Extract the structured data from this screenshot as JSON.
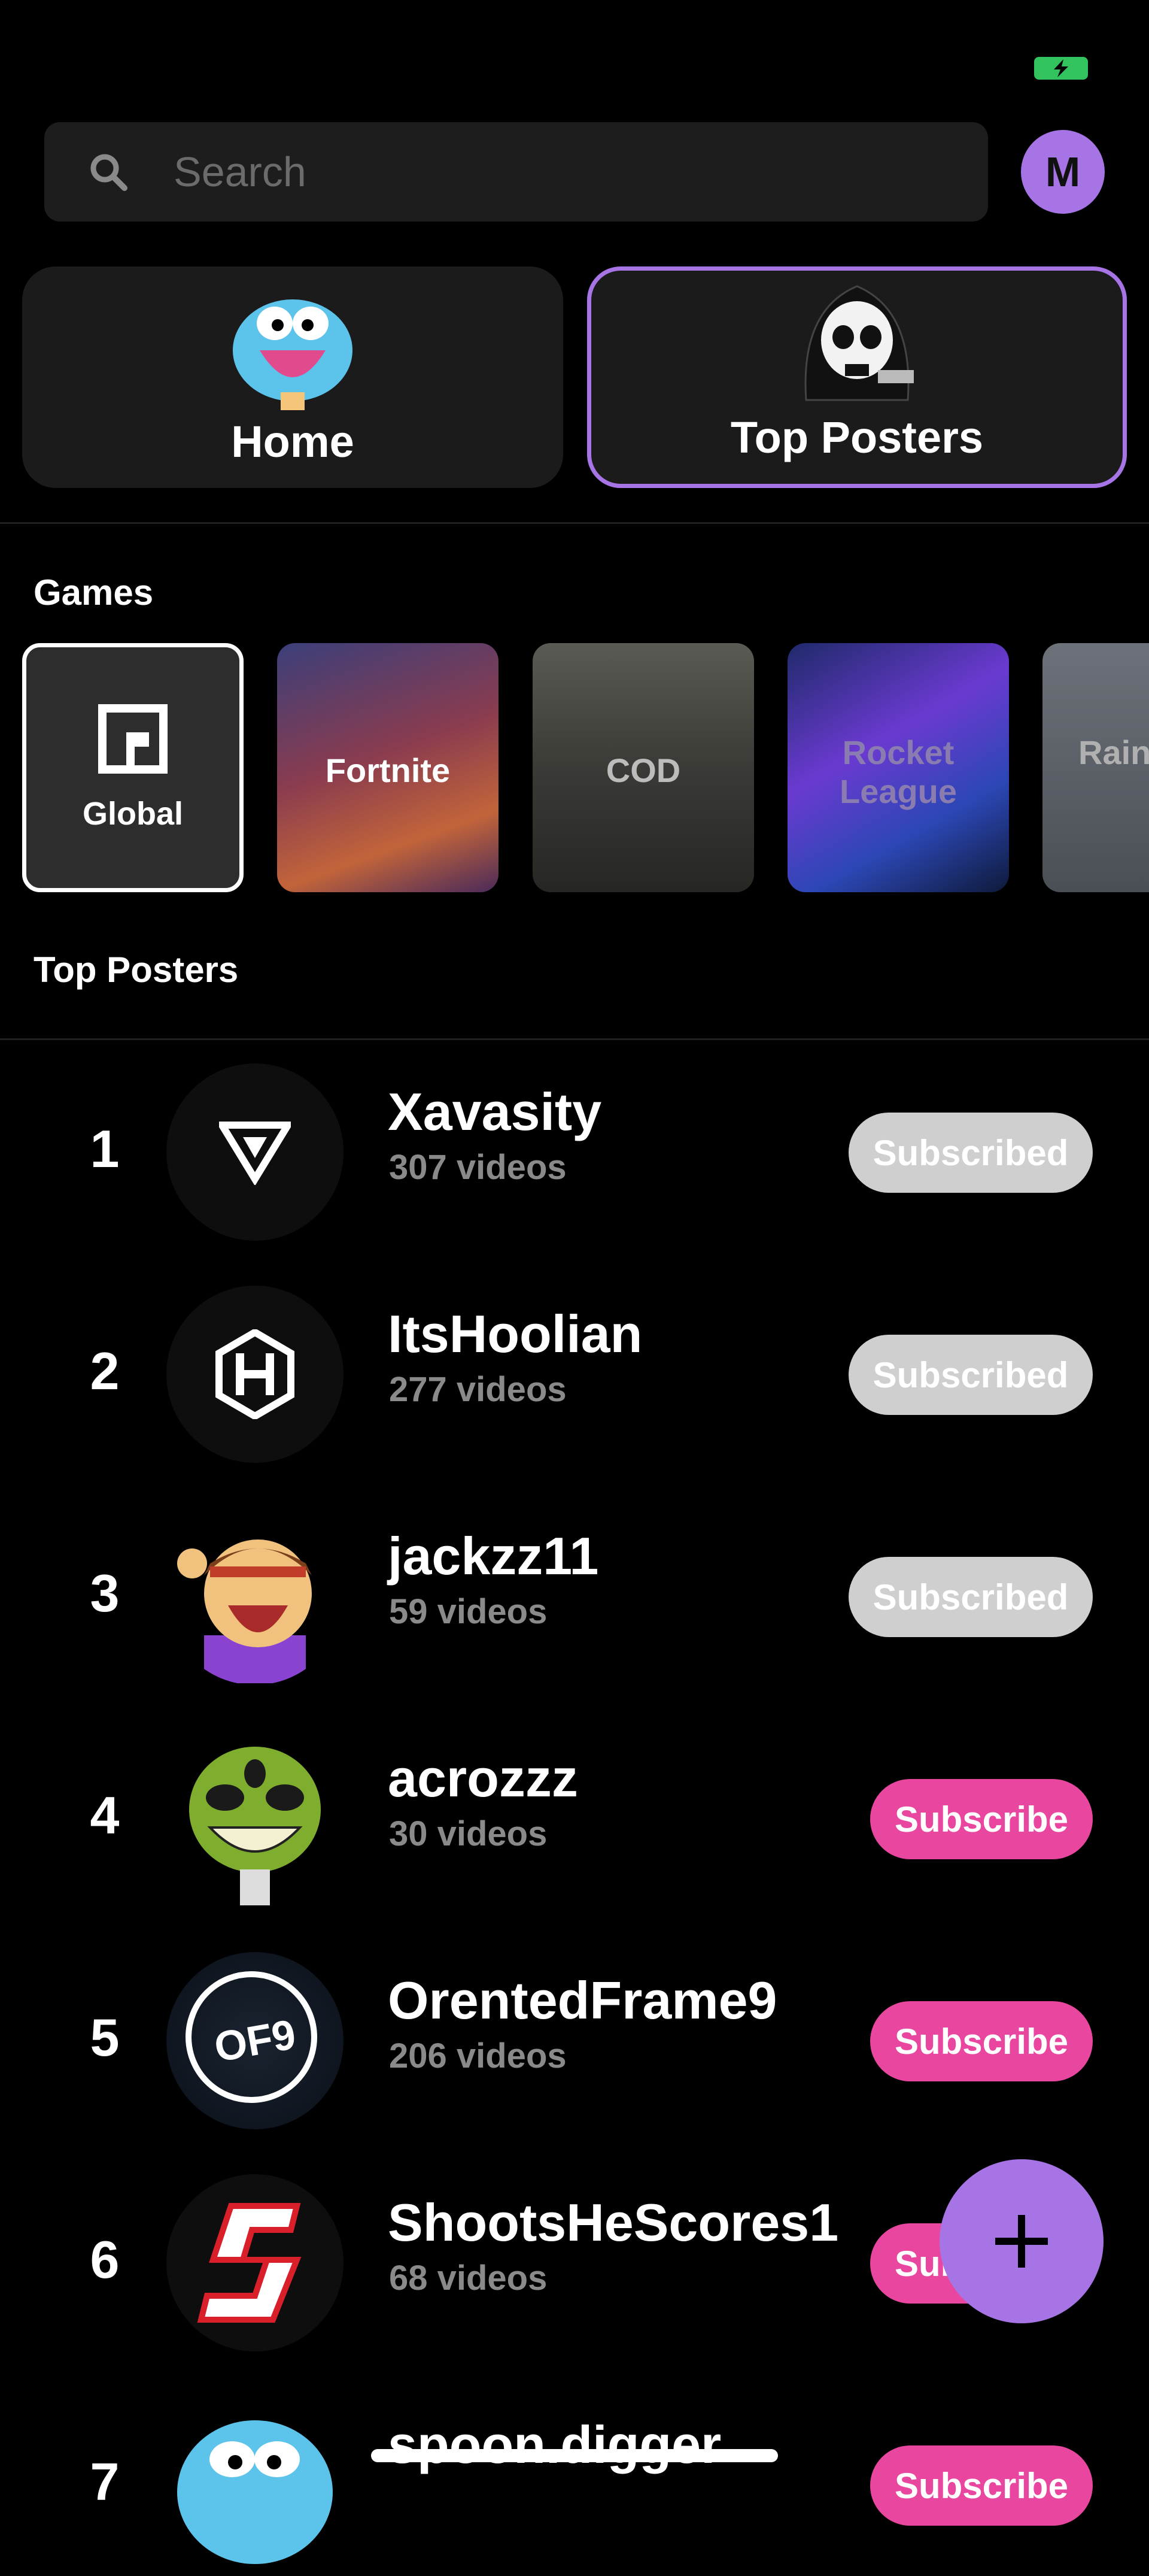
{
  "status": {
    "battery_icon": "battery-charging-icon",
    "battery_color": "#32c25e"
  },
  "search": {
    "placeholder": "Search",
    "icon": "search-icon"
  },
  "profile": {
    "initial": "M",
    "color": "#a774e6"
  },
  "tabs": [
    {
      "label": "Home",
      "icon": "gumball-icon"
    },
    {
      "label": "Top Posters",
      "icon": "skull-reaper-icon",
      "selected": true
    }
  ],
  "games_section": {
    "title": "Games"
  },
  "games": [
    {
      "label": "Global",
      "selected": true
    },
    {
      "label": "Fortnite"
    },
    {
      "label": "COD"
    },
    {
      "label": "Rocket League"
    },
    {
      "label": "Rainbow Six"
    }
  ],
  "top_posters_section": {
    "title": "Top Posters"
  },
  "posters": [
    {
      "rank": "1",
      "name": "Xavasity",
      "videos": "307 videos",
      "button": "Subscribed",
      "subscribed": true
    },
    {
      "rank": "2",
      "name": "ItsHoolian",
      "videos": "277 videos",
      "button": "Subscribed",
      "subscribed": true
    },
    {
      "rank": "3",
      "name": "jackzz11",
      "videos": "59 videos",
      "button": "Subscribed",
      "subscribed": true
    },
    {
      "rank": "4",
      "name": "acrozzz",
      "videos": "30 videos",
      "button": "Subscribe",
      "subscribed": false
    },
    {
      "rank": "5",
      "name": "OrentedFrame9",
      "videos": "206 videos",
      "button": "Subscribe",
      "subscribed": false
    },
    {
      "rank": "6",
      "name": "ShootsHeScores1",
      "videos": "68 videos",
      "button": "Subscribe",
      "subscribed": false
    },
    {
      "rank": "7",
      "name": "spoon.digger",
      "videos": "",
      "button": "Subscribe",
      "subscribed": false
    }
  ],
  "of9_text": "OF9",
  "colors": {
    "accent": "#a774e6",
    "subscribe": "#e9479f",
    "subscribed": "#cfcfcf"
  }
}
